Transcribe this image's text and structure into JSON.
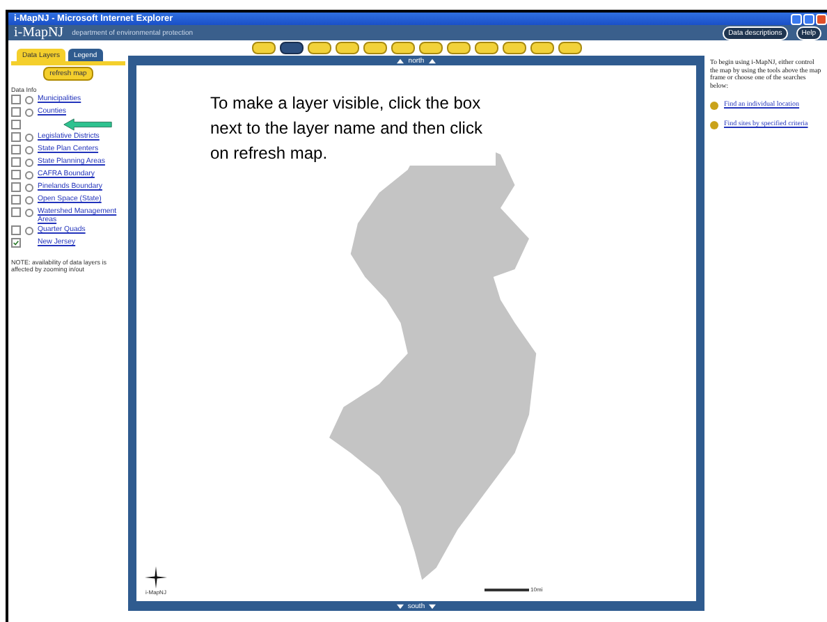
{
  "window": {
    "title": "i-MapNJ - Microsoft Internet Explorer"
  },
  "header": {
    "logo": "i-MapNJ",
    "subtitle": "department of environmental protection",
    "buttons": [
      "Data descriptions",
      "Help"
    ]
  },
  "toolbar": {
    "tools": [
      {
        "selected": false
      },
      {
        "selected": true
      },
      {
        "selected": false
      },
      {
        "selected": false
      },
      {
        "selected": false
      },
      {
        "selected": false
      },
      {
        "selected": false
      },
      {
        "selected": false
      },
      {
        "selected": false
      },
      {
        "selected": false
      },
      {
        "selected": false
      },
      {
        "selected": false
      }
    ]
  },
  "sidebar": {
    "tabs": [
      {
        "label": "Data Layers",
        "selected": true
      },
      {
        "label": "Legend",
        "selected": false
      }
    ],
    "refresh": "refresh map",
    "heading": "Data Info",
    "layers": [
      {
        "kind": "radio",
        "label": "Municipalities",
        "checked": false,
        "selected": false
      },
      {
        "kind": "radio",
        "label": "Counties",
        "checked": false,
        "selected": false
      },
      {
        "kind": "plain",
        "checked": false
      },
      {
        "kind": "radio",
        "label": "Legislative Districts",
        "checked": false,
        "selected": false
      },
      {
        "kind": "radio",
        "label": "State Plan Centers",
        "checked": false,
        "selected": false
      },
      {
        "kind": "radio",
        "label": "State Planning Areas",
        "checked": false,
        "selected": false
      },
      {
        "kind": "radio",
        "label": "CAFRA Boundary",
        "checked": false,
        "selected": false
      },
      {
        "kind": "radio",
        "label": "Pinelands Boundary",
        "checked": false,
        "selected": false
      },
      {
        "kind": "radio",
        "label": "Open Space (State)",
        "checked": false,
        "selected": false
      },
      {
        "kind": "radio",
        "label": "Watershed Management Areas",
        "checked": false,
        "selected": false
      },
      {
        "kind": "radio",
        "label": "Quarter Quads",
        "checked": false,
        "selected": false
      },
      {
        "kind": "plain",
        "label": "New Jersey",
        "checked": true
      }
    ],
    "note": "NOTE: availability of data layers is affected by zooming in/out"
  },
  "map": {
    "north": "north",
    "south": "south",
    "compass_label": "i-MapNJ",
    "scale": "10mi"
  },
  "right_panel": {
    "intro": "To begin using i-MapNJ, either control the map by using the tools above the map frame or choose one of the searches below:",
    "links": [
      "Find an individual location",
      "Find sites by specified criteria"
    ]
  },
  "callout": "To make a layer visible, click the box next to the layer name and then click on refresh map."
}
